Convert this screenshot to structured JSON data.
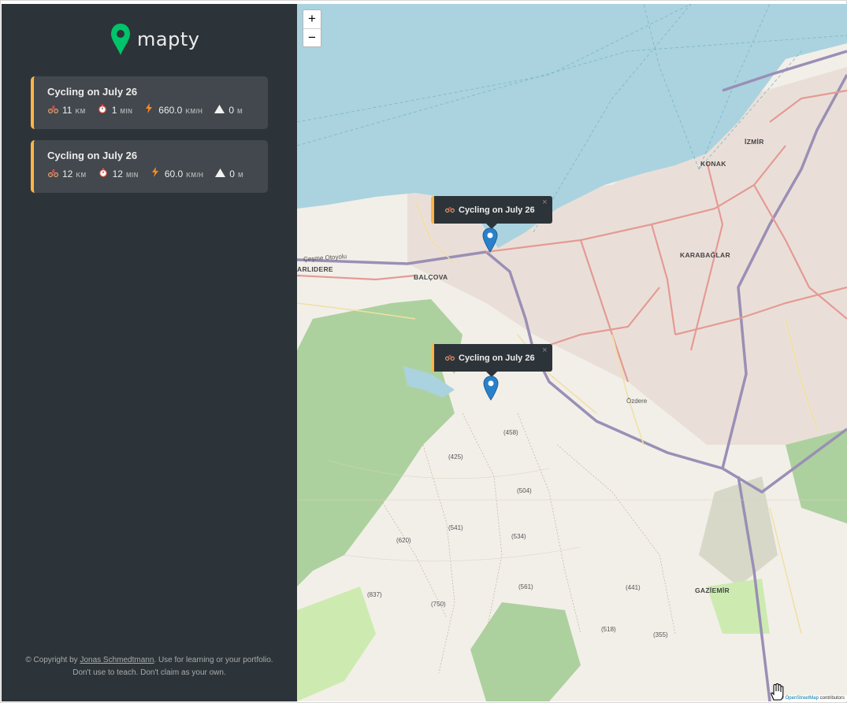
{
  "app": {
    "name": "mapty"
  },
  "workouts": [
    {
      "title": "Cycling on July 26",
      "distance": "11",
      "distance_unit": "km",
      "duration": "1",
      "duration_unit": "min",
      "speed": "660.0",
      "speed_unit": "km/h",
      "elevation": "0",
      "elevation_unit": "m"
    },
    {
      "title": "Cycling on July 26",
      "distance": "12",
      "distance_unit": "km",
      "duration": "12",
      "duration_unit": "min",
      "speed": "60.0",
      "speed_unit": "km/h",
      "elevation": "0",
      "elevation_unit": "m"
    }
  ],
  "icons": {
    "cycling": "cycling-icon",
    "duration": "stopwatch-icon",
    "speed": "lightning-icon",
    "elevation": "mountain-icon"
  },
  "footer": {
    "prefix": "© Copyright by ",
    "author": "Jonas Schmedtmann",
    "suffix": ". Use for learning or your portfolio. Don't use to teach. Don't claim as your own."
  },
  "map": {
    "zoom_in": "+",
    "zoom_out": "−",
    "popups": [
      {
        "label": "Cycling on July 26",
        "close": "×"
      },
      {
        "label": "Cycling on July 26",
        "close": "×"
      }
    ],
    "attribution_prefix": "© ",
    "attribution_link": "OpenStreetMap",
    "attribution_suffix": " contributors",
    "labels": {
      "izmir": "İZMİR",
      "konak": "KONAK",
      "karabaglar": "KARABAĞLAR",
      "balcova": "BALÇOVA",
      "narlidere": "ARLIDERE",
      "gaziemir": "GAZİEMİR",
      "cesme": "Çeşme Otoyolu",
      "ozdere": "Özdere",
      "p458": "(458)",
      "p425": "(425)",
      "p504": "(504)",
      "p541": "(541)",
      "p534": "(534)",
      "p620": "(620)",
      "p561": "(561)",
      "p837": "(837)",
      "p750": "(750)",
      "p441": "(441)",
      "p518": "(518)",
      "p355": "(355)"
    }
  },
  "colors": {
    "accent_cycling": "#ffb545",
    "brand_green": "#00c46a",
    "sidebar_bg": "#2d3439",
    "card_bg": "#42484d",
    "sea": "#aad3df"
  }
}
